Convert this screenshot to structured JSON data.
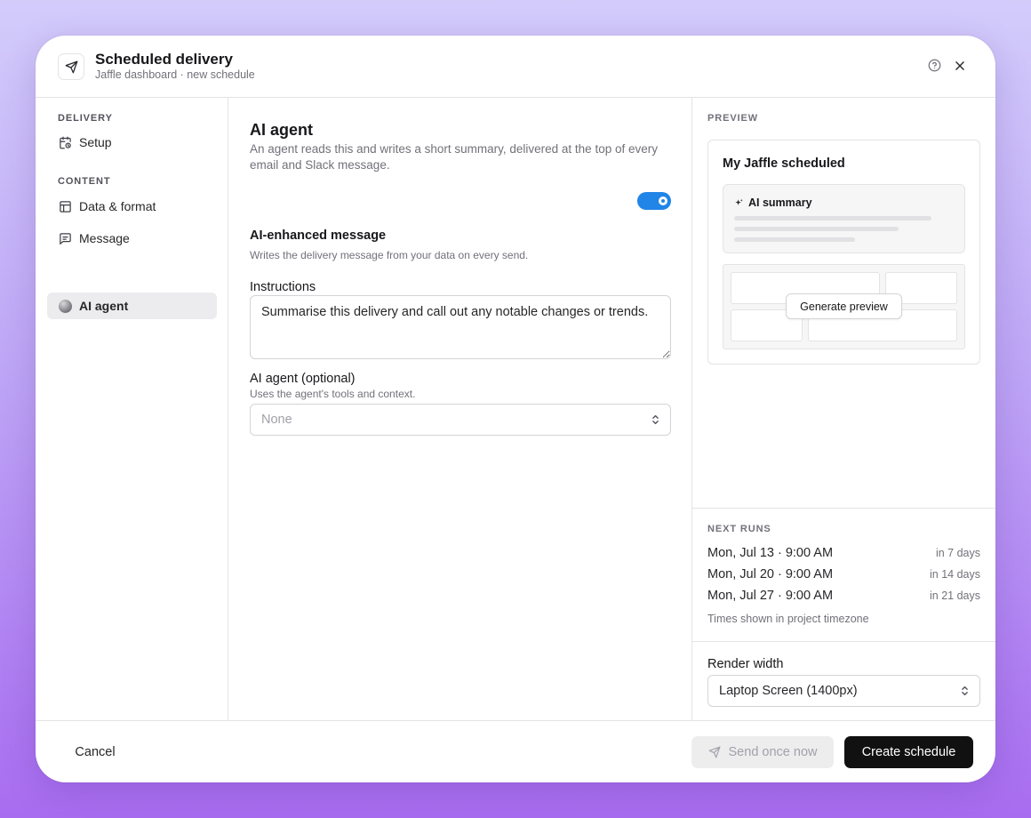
{
  "header": {
    "title": "Scheduled delivery",
    "subtitle": "Jaffle dashboard · new schedule",
    "icon": "send-icon"
  },
  "sidebar": {
    "sections": [
      {
        "label": "DELIVERY",
        "items": [
          {
            "label": "Setup",
            "icon": "calendar-clock-icon"
          }
        ]
      },
      {
        "label": "CONTENT",
        "items": [
          {
            "label": "Data & format",
            "icon": "table-icon"
          },
          {
            "label": "Message",
            "icon": "message-icon"
          },
          {
            "label": "AI agent",
            "icon": "agent-orb-icon",
            "active": true
          }
        ]
      }
    ]
  },
  "main": {
    "title": "AI agent",
    "description": "An agent reads this and writes a short summary, delivered at the top of every email and Slack message.",
    "ai_enhanced": {
      "label": "AI-enhanced message",
      "hint": "Writes the delivery message from your data on every send.",
      "enabled": true
    },
    "instructions": {
      "label": "Instructions",
      "value": "Summarise this delivery and call out any notable changes or trends."
    },
    "agent": {
      "label": "AI agent (optional)",
      "hint": "Uses the agent's tools and context.",
      "placeholder": "None"
    }
  },
  "preview": {
    "section_label": "PREVIEW",
    "card_title": "My Jaffle scheduled",
    "ai_summary_label": "AI summary",
    "generate_label": "Generate preview"
  },
  "next_runs": {
    "section_label": "NEXT RUNS",
    "runs": [
      {
        "date": "Mon, Jul 13 · 9:00 AM",
        "relative": "in 7 days"
      },
      {
        "date": "Mon, Jul 20 · 9:00 AM",
        "relative": "in 14 days"
      },
      {
        "date": "Mon, Jul 27 · 9:00 AM",
        "relative": "in 21 days"
      }
    ],
    "timezone_note": "Times shown in project timezone"
  },
  "render_width": {
    "label": "Render width",
    "value": "Laptop Screen (1400px)"
  },
  "footer": {
    "cancel_label": "Cancel",
    "send_label": "Send once now",
    "create_label": "Create schedule"
  },
  "colors": {
    "accent": "#2185e8",
    "primary_button": "#111111",
    "background_top": "#d3ccfb",
    "background_bottom": "#a86cf0"
  }
}
